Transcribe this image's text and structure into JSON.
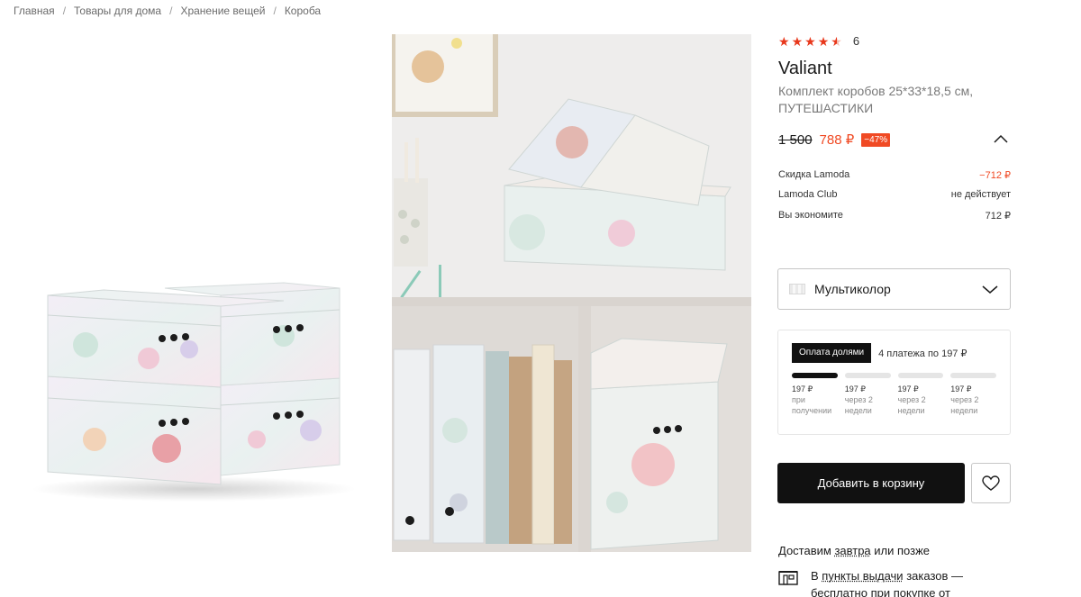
{
  "breadcrumb": [
    "Главная",
    "Товары для дома",
    "Хранение вещей",
    "Короба"
  ],
  "rating": {
    "stars": 4.5,
    "count": "6"
  },
  "product": {
    "brand": "Valiant",
    "name": "Комплект коробов 25*33*18,5 см, ПУТЕШАСТИКИ"
  },
  "price": {
    "old": "1 500",
    "new": "788 ₽",
    "discount": "−47%"
  },
  "details": [
    {
      "label": "Скидка Lamoda",
      "value": "−712 ₽"
    },
    {
      "label": "Lamoda Club",
      "value": "не действует"
    },
    {
      "label": "Вы экономите",
      "value": "712 ₽"
    }
  ],
  "color": {
    "selected": "Мультиколор"
  },
  "installments": {
    "badge": "Оплата долями",
    "summary": "4 платежа по 197 ₽",
    "payments": [
      {
        "amount": "197 ₽",
        "when": "при получении"
      },
      {
        "amount": "197 ₽",
        "when": "через 2 недели"
      },
      {
        "amount": "197 ₽",
        "when": "через 2 недели"
      },
      {
        "amount": "197 ₽",
        "when": "через 2 недели"
      }
    ]
  },
  "actions": {
    "add_to_cart": "Добавить в корзину"
  },
  "delivery": {
    "prefix": "Доставим ",
    "link": "завтра",
    "suffix": " или позже",
    "pickup_prefix": "В ",
    "pickup_link": "пункты выдачи",
    "pickup_suffix": " заказов — бесплатно при покупке от"
  },
  "colors": {
    "accent": "#f04a24",
    "dark": "#111111"
  }
}
